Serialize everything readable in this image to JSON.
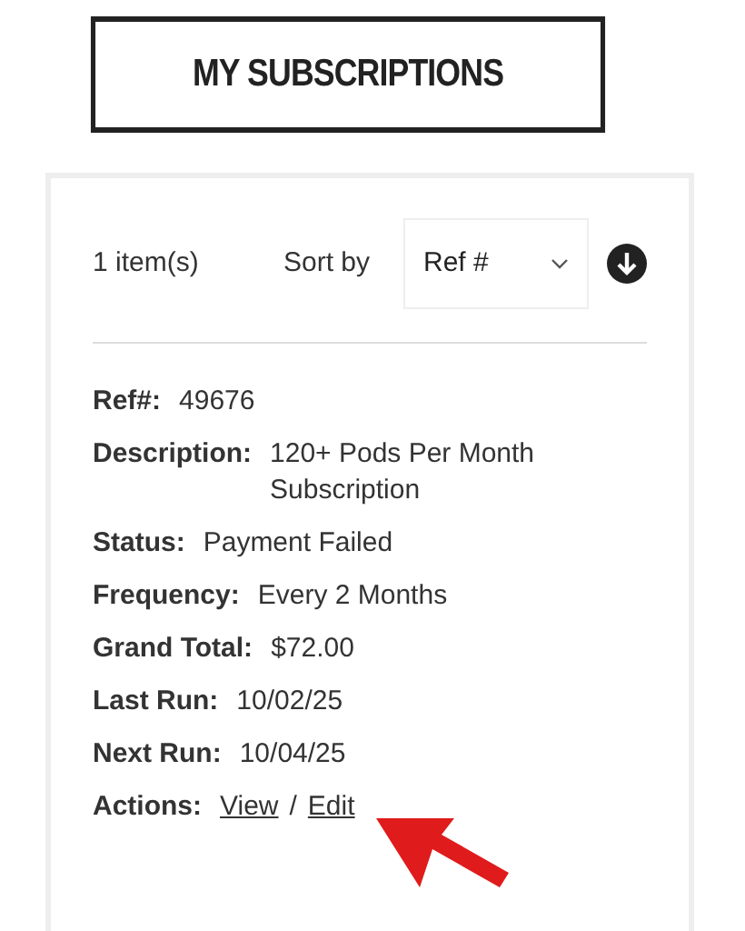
{
  "title": "MY SUBSCRIPTIONS",
  "toolbar": {
    "count": "1 item(s)",
    "sort_label": "Sort by",
    "sort_value": "Ref #"
  },
  "fields": [
    {
      "label": "Ref#:",
      "value": "49676"
    },
    {
      "label": "Description:",
      "value": "120+ Pods Per Month Subscription"
    },
    {
      "label": "Status:",
      "value": "Payment Failed"
    },
    {
      "label": "Frequency:",
      "value": "Every 2 Months"
    },
    {
      "label": "Grand Total:",
      "value": "$72.00"
    },
    {
      "label": "Last Run:",
      "value": "10/02/25"
    },
    {
      "label": "Next Run:",
      "value": "10/04/25"
    }
  ],
  "actions": {
    "label": "Actions:",
    "links": [
      "View",
      "Edit"
    ],
    "separator": "/"
  }
}
